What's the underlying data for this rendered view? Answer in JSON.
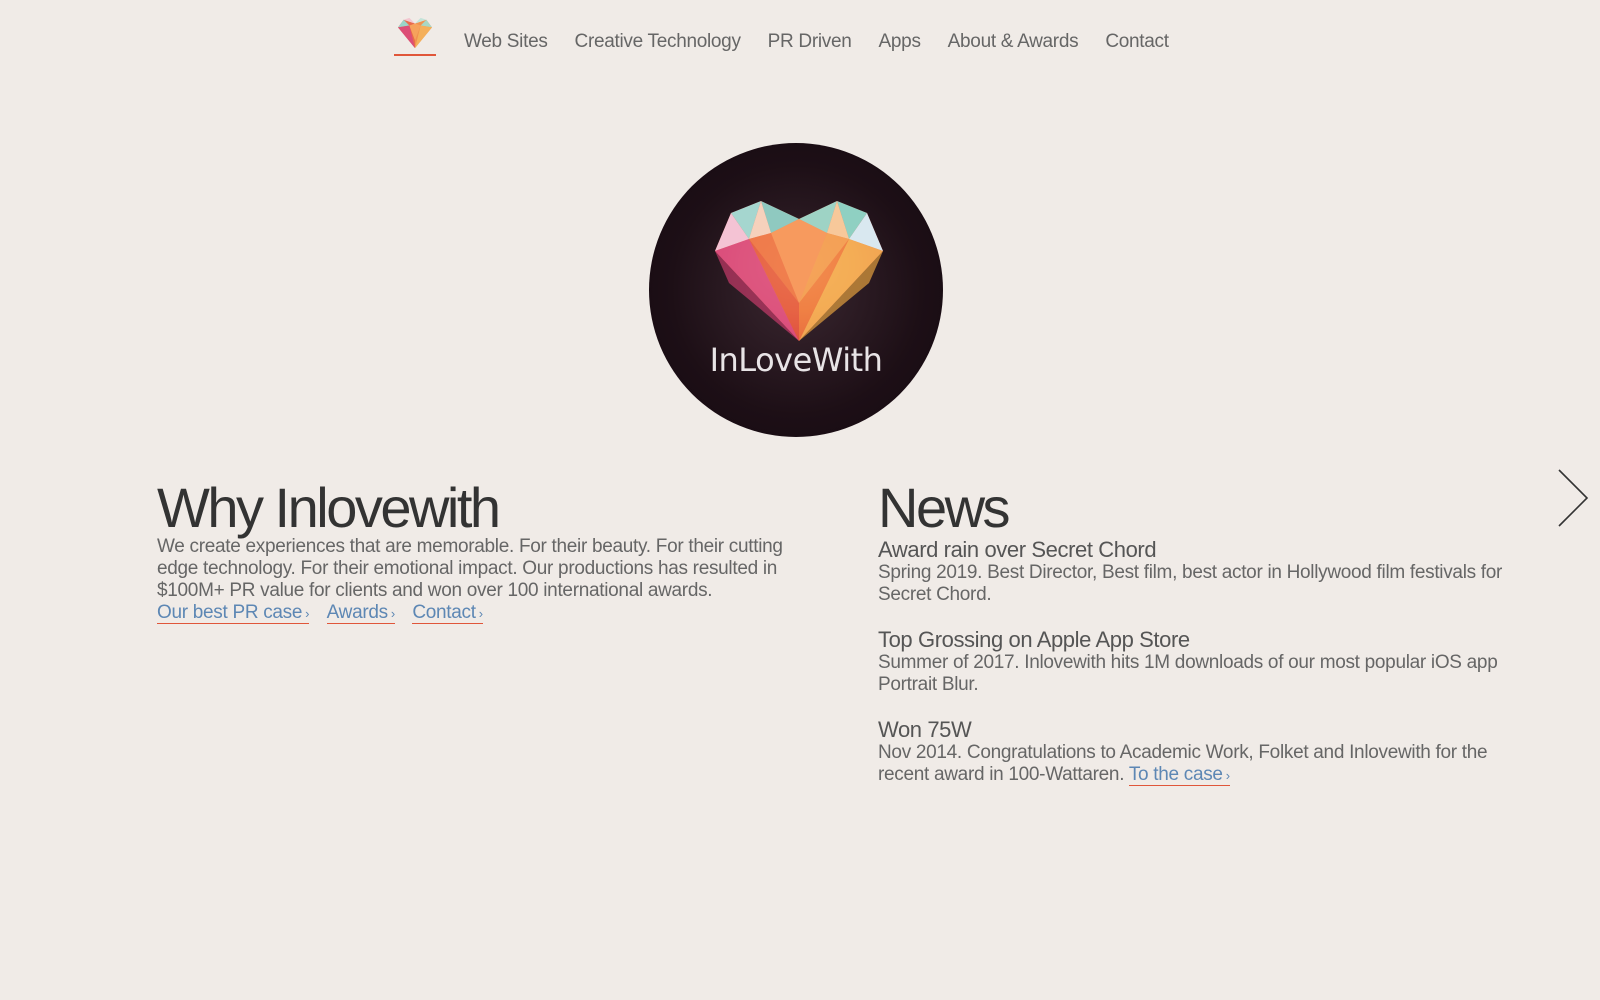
{
  "nav": {
    "logo_icon": "heart-gem-icon",
    "items": [
      {
        "label": "Web Sites"
      },
      {
        "label": "Creative Technology"
      },
      {
        "label": "PR Driven"
      },
      {
        "label": "Apps"
      },
      {
        "label": "About & Awards"
      },
      {
        "label": "Contact"
      }
    ]
  },
  "hero": {
    "title": "InLoveWith"
  },
  "why": {
    "heading": "Why Inlovewith",
    "body": "We create experiences that are memorable. For their beauty. For their cutting edge technology. For their emotional impact. Our productions has resulted in $100M+ PR value for clients and won over 100 international awards.",
    "links": [
      {
        "label": "Our best PR case"
      },
      {
        "label": "Awards"
      },
      {
        "label": "Contact"
      }
    ],
    "chevron": "›"
  },
  "news": {
    "heading": "News",
    "items": [
      {
        "title": "Award rain over Secret Chord",
        "body": "Spring 2019. Best Director, Best film, best actor in Hollywood film festivals for Secret Chord."
      },
      {
        "title": "Top Grossing on Apple App Store",
        "body": "Summer of 2017. Inlovewith hits 1M downloads of our most popular iOS app Portrait Blur."
      },
      {
        "title": "Won 75W",
        "body": "Nov 2014. Congratulations to Academic Work, Folket and Inlovewith for the recent award in 100-Wattaren.",
        "link": "To the case"
      }
    ]
  },
  "colors": {
    "background": "#f0ebe7",
    "link": "#5d87b4",
    "underline": "#e0563a",
    "text": "#666666",
    "heading": "#333333",
    "hero_bg": "#1d0f16"
  },
  "next_arrow_icon": "chevron-right-icon"
}
